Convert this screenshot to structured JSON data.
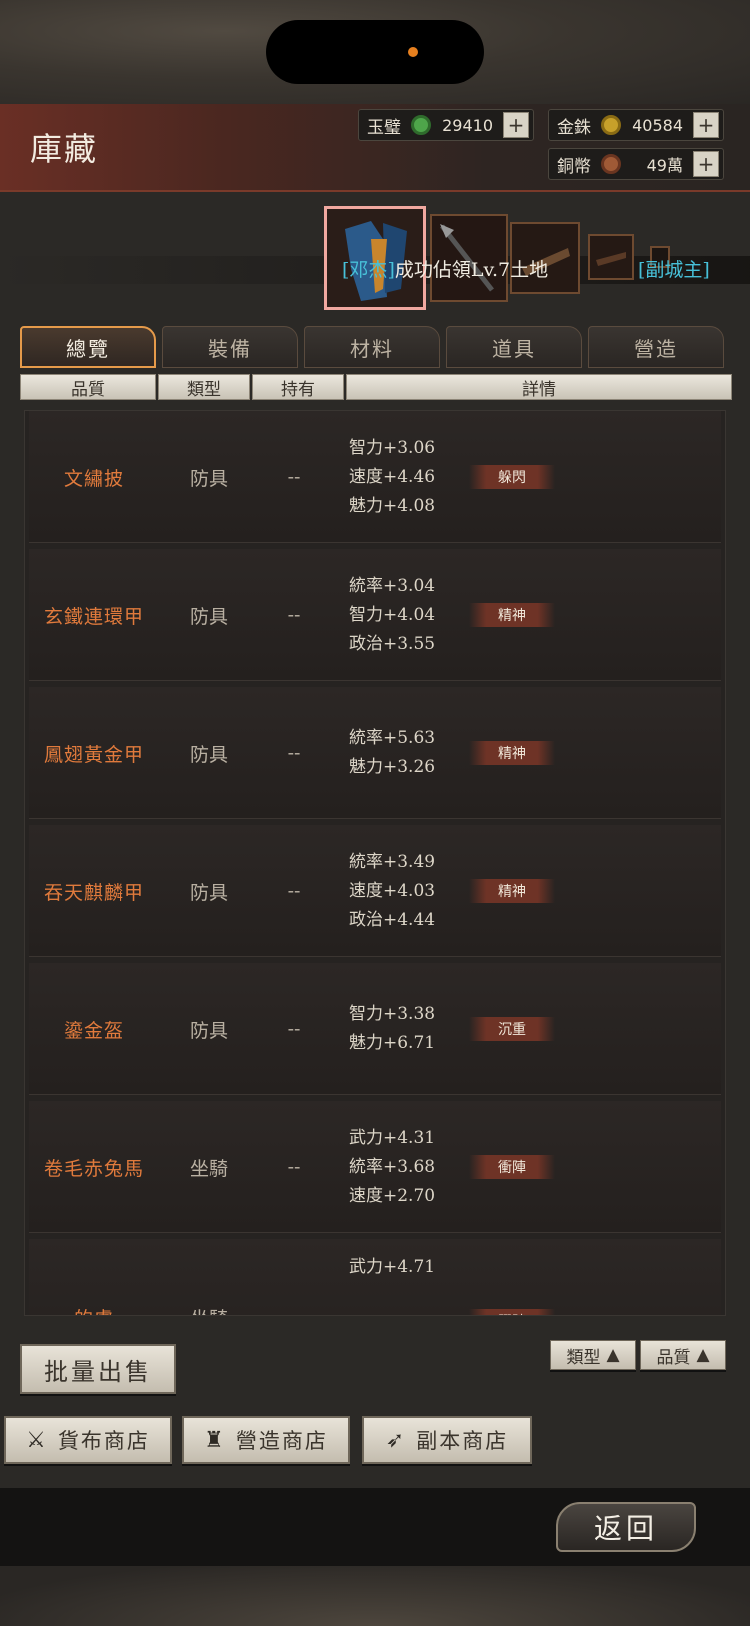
{
  "header": {
    "title": "庫藏"
  },
  "currency": [
    {
      "label": "玉璧",
      "value": "29410",
      "coin_color": "#4ea54a"
    },
    {
      "label": "金銖",
      "value": "40584",
      "coin_color": "#c7a02a"
    },
    {
      "label": "銅幣",
      "value": "49萬",
      "coin_color": "#a05a36"
    }
  ],
  "banner": {
    "name": "邓杰",
    "message": "成功佔領Lv.7土地",
    "tag": "[副城主]"
  },
  "tabs": [
    "總覽",
    "裝備",
    "材料",
    "道具",
    "營造"
  ],
  "columns": [
    "品質",
    "類型",
    "持有",
    "詳情"
  ],
  "items": [
    {
      "name": "文繡披",
      "type": "防具",
      "owned": "--",
      "stats": [
        "智力+3.06",
        "速度+4.46",
        "魅力+4.08"
      ],
      "trait": "躲閃"
    },
    {
      "name": "玄鐵連環甲",
      "type": "防具",
      "owned": "--",
      "stats": [
        "統率+3.04",
        "智力+4.04",
        "政治+3.55"
      ],
      "trait": "精神"
    },
    {
      "name": "鳳翅黃金甲",
      "type": "防具",
      "owned": "--",
      "stats": [
        "統率+5.63",
        "魅力+3.26"
      ],
      "trait": "精神"
    },
    {
      "name": "吞天麒麟甲",
      "type": "防具",
      "owned": "--",
      "stats": [
        "統率+3.49",
        "速度+4.03",
        "政治+4.44"
      ],
      "trait": "精神"
    },
    {
      "name": "鎏金盔",
      "type": "防具",
      "owned": "--",
      "stats": [
        "智力+3.38",
        "魅力+6.71"
      ],
      "trait": "沉重"
    },
    {
      "name": "卷毛赤兔馬",
      "type": "坐騎",
      "owned": "--",
      "stats": [
        "武力+4.31",
        "統率+3.68",
        "速度+2.70"
      ],
      "trait": "衝陣"
    },
    {
      "name": "的盧",
      "type": "坐騎",
      "owned": "--",
      "stats": [
        "武力+4.71"
      ],
      "trait": "躍踏"
    }
  ],
  "actions": {
    "bulk_sell": "批量出售",
    "sort_type": "類型",
    "sort_quality": "品質"
  },
  "shops": [
    "貨布商店",
    "營造商店",
    "副本商店"
  ],
  "back_label": "返回"
}
